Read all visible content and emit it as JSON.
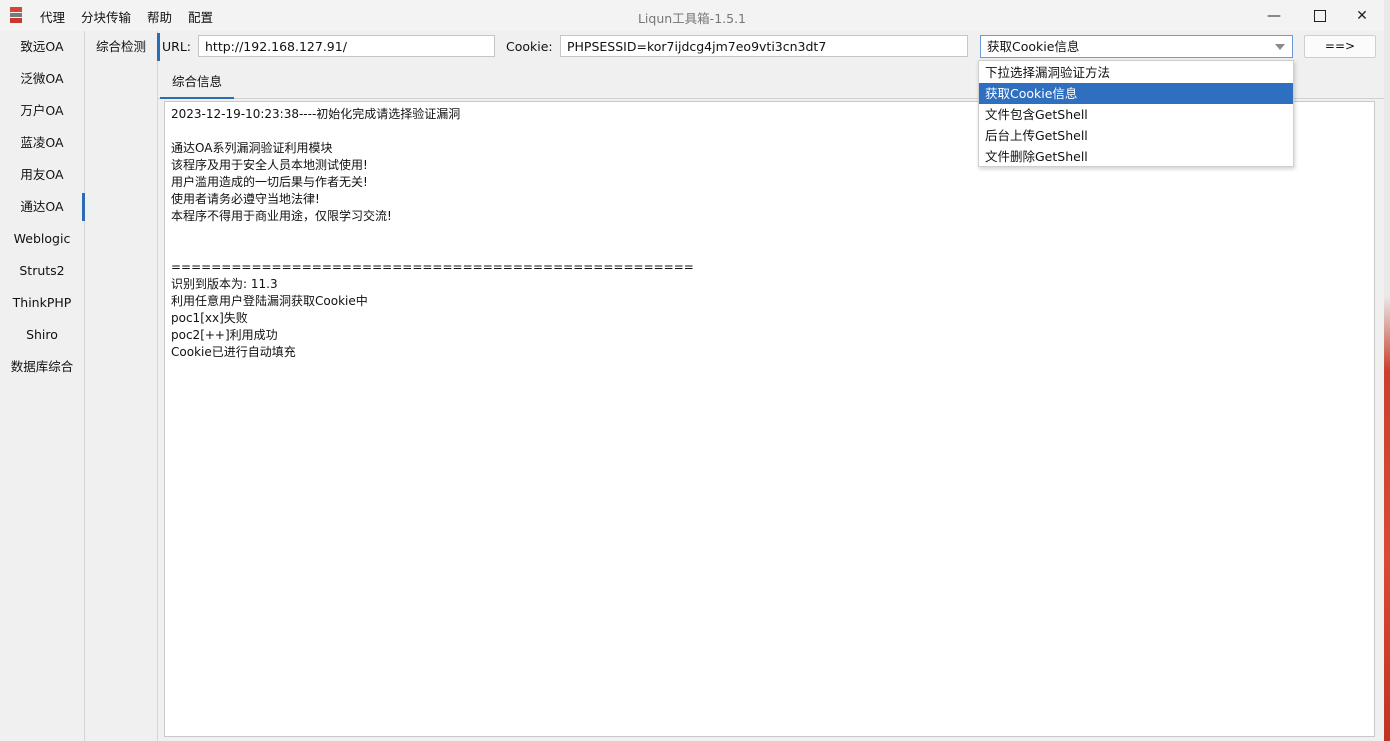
{
  "window": {
    "title": "Liqun工具箱-1.5.1",
    "menu": [
      "代理",
      "分块传输",
      "帮助",
      "配置"
    ],
    "controls": {
      "minimize": "—",
      "close": "✕"
    }
  },
  "sidebar": {
    "items": [
      {
        "label": "致远OA"
      },
      {
        "label": "泛微OA"
      },
      {
        "label": "万户OA"
      },
      {
        "label": "蓝凌OA"
      },
      {
        "label": "用友OA"
      },
      {
        "label": "通达OA",
        "active": true
      },
      {
        "label": "Weblogic"
      },
      {
        "label": "Struts2"
      },
      {
        "label": "ThinkPHP"
      },
      {
        "label": "Shiro"
      },
      {
        "label": "数据库综合"
      }
    ]
  },
  "subnav": {
    "items": [
      {
        "label": "综合检测",
        "active": true
      }
    ]
  },
  "toolbar": {
    "url_label": "URL:",
    "url_value": "http://192.168.127.91/",
    "cookie_label": "Cookie:",
    "cookie_value": "PHPSESSID=kor7ijdcg4jm7eo9vti3cn3dt7",
    "method_selected": "获取Cookie信息",
    "run_label": "==>"
  },
  "dropdown": {
    "options": [
      "下拉选择漏洞验证方法",
      "获取Cookie信息",
      "文件包含GetShell",
      "后台上传GetShell",
      "文件删除GetShell"
    ],
    "selected_index": 1
  },
  "tabs": [
    {
      "label": "综合信息"
    }
  ],
  "output": {
    "lines": [
      "2023-12-19-10:23:38----初始化完成请选择验证漏洞",
      "",
      "通达OA系列漏洞验证利用模块",
      "该程序及用于安全人员本地测试使用!",
      "用户滥用造成的一切后果与作者无关!",
      "使用者请务必遵守当地法律!",
      "本程序不得用于商业用途，仅限学习交流!",
      "",
      "",
      "====================================================",
      "识别到版本为: 11.3",
      "利用任意用户登陆漏洞获取Cookie中",
      "poc1[xx]失败",
      "poc2[++]利用成功",
      "Cookie已进行自动填充"
    ]
  },
  "colors": {
    "accent": "#2b6cb6",
    "selection": "#2f6fc0",
    "background": "#f0f0f0"
  }
}
